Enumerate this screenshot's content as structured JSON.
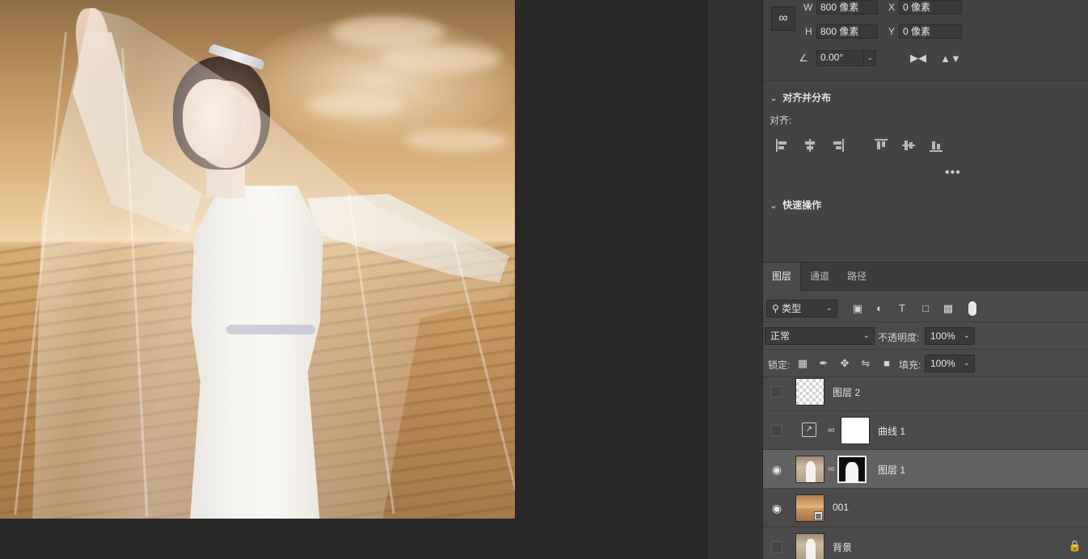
{
  "properties": {
    "transform": {
      "w_label": "W",
      "w_value": "800 像素",
      "h_label": "H",
      "h_value": "800 像素",
      "x_label": "X",
      "x_value": "0 像素",
      "y_label": "Y",
      "y_value": "0 像素",
      "angle_value": "0.00°"
    },
    "align_section": {
      "title": "对齐并分布",
      "align_label": "对齐:",
      "more": "•••"
    },
    "quick_actions_section": {
      "title": "快速操作"
    }
  },
  "layers_panel": {
    "tabs": [
      {
        "label": "图层",
        "active": true
      },
      {
        "label": "通道",
        "active": false
      },
      {
        "label": "路径",
        "active": false
      }
    ],
    "filter": {
      "label": "类型"
    },
    "blend_mode": "正常",
    "opacity_label": "不透明度:",
    "opacity_value": "100%",
    "lock_label": "锁定:",
    "fill_label": "填充:",
    "fill_value": "100%",
    "layers": [
      {
        "name": "图层 2",
        "visible": false,
        "selected": false,
        "thumbnail": "transparent"
      },
      {
        "name": "曲线 1",
        "visible": false,
        "selected": false,
        "thumbnail": "curves-adjustment-with-white-mask"
      },
      {
        "name": "图层 1",
        "visible": true,
        "selected": true,
        "thumbnail": "bride-photo-with-mask"
      },
      {
        "name": "001",
        "visible": true,
        "selected": false,
        "thumbnail": "desert-smart-object"
      },
      {
        "name": "背景",
        "visible": false,
        "selected": false,
        "thumbnail": "bride-photo",
        "locked": true
      }
    ]
  },
  "icons": {
    "link": "link-icon",
    "angle": "angle-icon",
    "flip_horizontal": "flip-horizontal-icon",
    "flip_vertical": "flip-vertical-icon",
    "search": "search-icon",
    "eye": "eye-icon",
    "lock": "lock-icon"
  },
  "colors": {
    "panel_bg": "#434343",
    "layers_bg": "#4a4a4a",
    "selected_row": "#626262",
    "canvas_bg": "#282828"
  }
}
